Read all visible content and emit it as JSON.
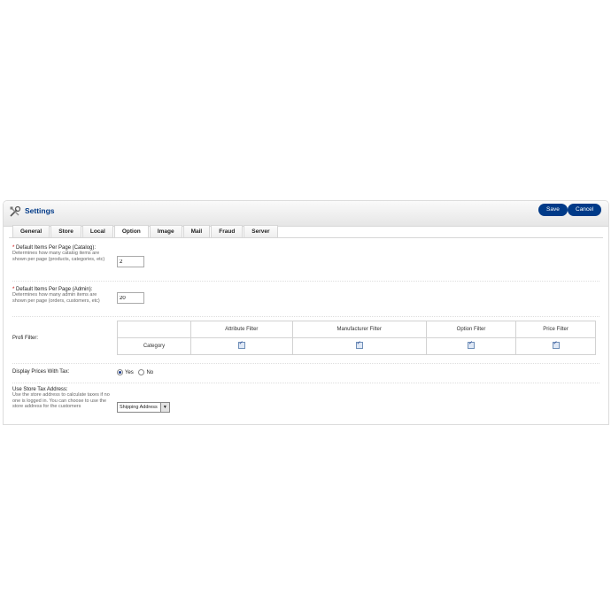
{
  "header": {
    "title": "Settings",
    "save_label": "Save",
    "cancel_label": "Cancel"
  },
  "tabs": [
    "General",
    "Store",
    "Local",
    "Option",
    "Image",
    "Mail",
    "Fraud",
    "Server"
  ],
  "active_tab": "Option",
  "fields": {
    "catalog_items": {
      "required": "*",
      "label": "Default Items Per Page (Catalog):",
      "help": "Determines how many catalog items are shown per page (products, categories, etc)",
      "value": "2"
    },
    "admin_items": {
      "required": "*",
      "label": "Default Items Per Page (Admin):",
      "help": "Determines how many admin items are shown per page (orders, customers, etc)",
      "value": "20"
    },
    "profi_filter": {
      "label": "Profi Filter:",
      "columns": [
        "Attribute Filter",
        "Manufacturer Filter",
        "Option Filter",
        "Price Filter"
      ],
      "row_label": "Category"
    },
    "display_prices_tax": {
      "label": "Display Prices With Tax:",
      "yes": "Yes",
      "no": "No",
      "selected": "Yes"
    },
    "store_tax_address": {
      "label": "Use Store Tax Address:",
      "help": "Use the store address to calculate taxes if no one is logged in. You can choose to use the store address for the customers",
      "value": "Shipping Address"
    }
  }
}
